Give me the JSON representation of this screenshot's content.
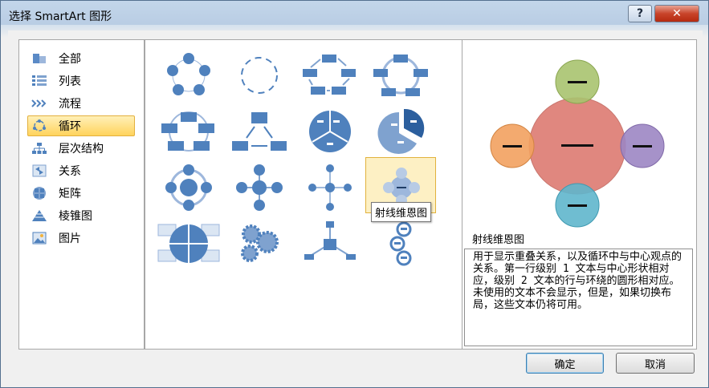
{
  "dialog": {
    "title": "选择 SmartArt 图形",
    "help_label": "?",
    "close_label": "✕"
  },
  "categories": [
    {
      "label": "全部",
      "icon": "all-icon"
    },
    {
      "label": "列表",
      "icon": "list-icon"
    },
    {
      "label": "流程",
      "icon": "process-icon"
    },
    {
      "label": "循环",
      "icon": "cycle-icon"
    },
    {
      "label": "层次结构",
      "icon": "hierarchy-icon"
    },
    {
      "label": "关系",
      "icon": "relationship-icon"
    },
    {
      "label": "矩阵",
      "icon": "matrix-icon"
    },
    {
      "label": "棱锥图",
      "icon": "pyramid-icon"
    },
    {
      "label": "图片",
      "icon": "picture-icon"
    }
  ],
  "selected_category": "循环",
  "tooltip": "射线维恩图",
  "preview": {
    "title": "射线维恩图",
    "description": "用于显示重叠关系，以及循环中与中心观点的关系。第一行级别 1 文本与中心形状相对应，级别 2 文本的行与环绕的圆形相对应。未使用的文本不会显示，但是，如果切换布局，这些文本仍将可用。",
    "colors": {
      "center": "#e0877f",
      "top": "#a9c36f",
      "left": "#f2a15f",
      "right": "#9c86c3",
      "bottom": "#5fb6cc"
    }
  },
  "buttons": {
    "ok": "确定",
    "cancel": "取消"
  },
  "accent": "#4f81bd"
}
